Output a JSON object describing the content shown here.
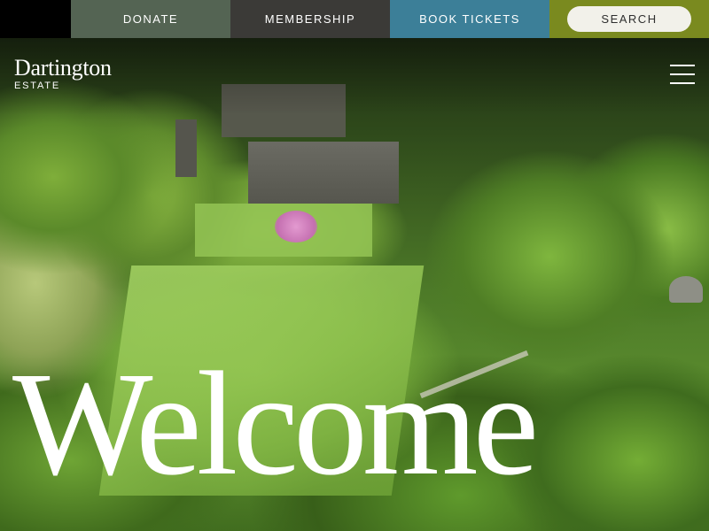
{
  "nav": {
    "donate_label": "DONATE",
    "membership_label": "MEMBERSHIP",
    "book_tickets_label": "BOOK TICKETS",
    "search_label": "SEARCH"
  },
  "brand": {
    "name": "Dartington",
    "sub": "ESTATE"
  },
  "hero": {
    "headline": "Welcome"
  },
  "colors": {
    "donate": "#546453",
    "membership": "#3b3a37",
    "book_tickets": "#3c7f98",
    "search_bar": "#7a8a1f"
  },
  "icons": {
    "menu": "hamburger-menu-icon"
  }
}
